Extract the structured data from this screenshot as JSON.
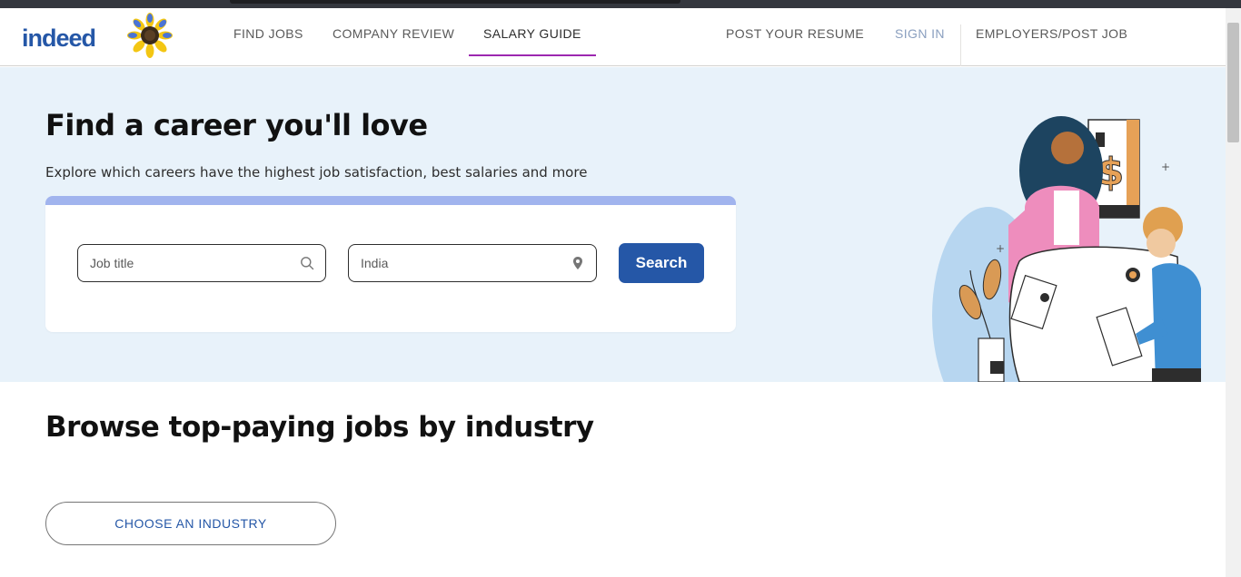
{
  "header": {
    "logo": "indeed",
    "nav": {
      "find_jobs": "FIND JOBS",
      "company_review": "COMPANY REVIEW",
      "salary_guide": "SALARY GUIDE",
      "post_resume": "POST YOUR RESUME",
      "sign_in": "SIGN IN",
      "employers": "EMPLOYERS/POST JOB"
    },
    "active_tab": "SALARY GUIDE"
  },
  "hero": {
    "title": "Find a career you'll love",
    "subtitle": "Explore which careers have the highest job satisfaction, best salaries and more",
    "search": {
      "job_placeholder": "Job title",
      "location_value": "India",
      "button_label": "Search"
    },
    "illustration_money_symbol": "$"
  },
  "browse": {
    "title": "Browse top-paying jobs by industry",
    "choose_label": "CHOOSE AN INDUSTRY"
  },
  "colors": {
    "brand_blue": "#2557a7",
    "active_underline": "#9c27b0",
    "hero_bg": "#e8f2fa",
    "card_band": "#a1b4ee"
  }
}
